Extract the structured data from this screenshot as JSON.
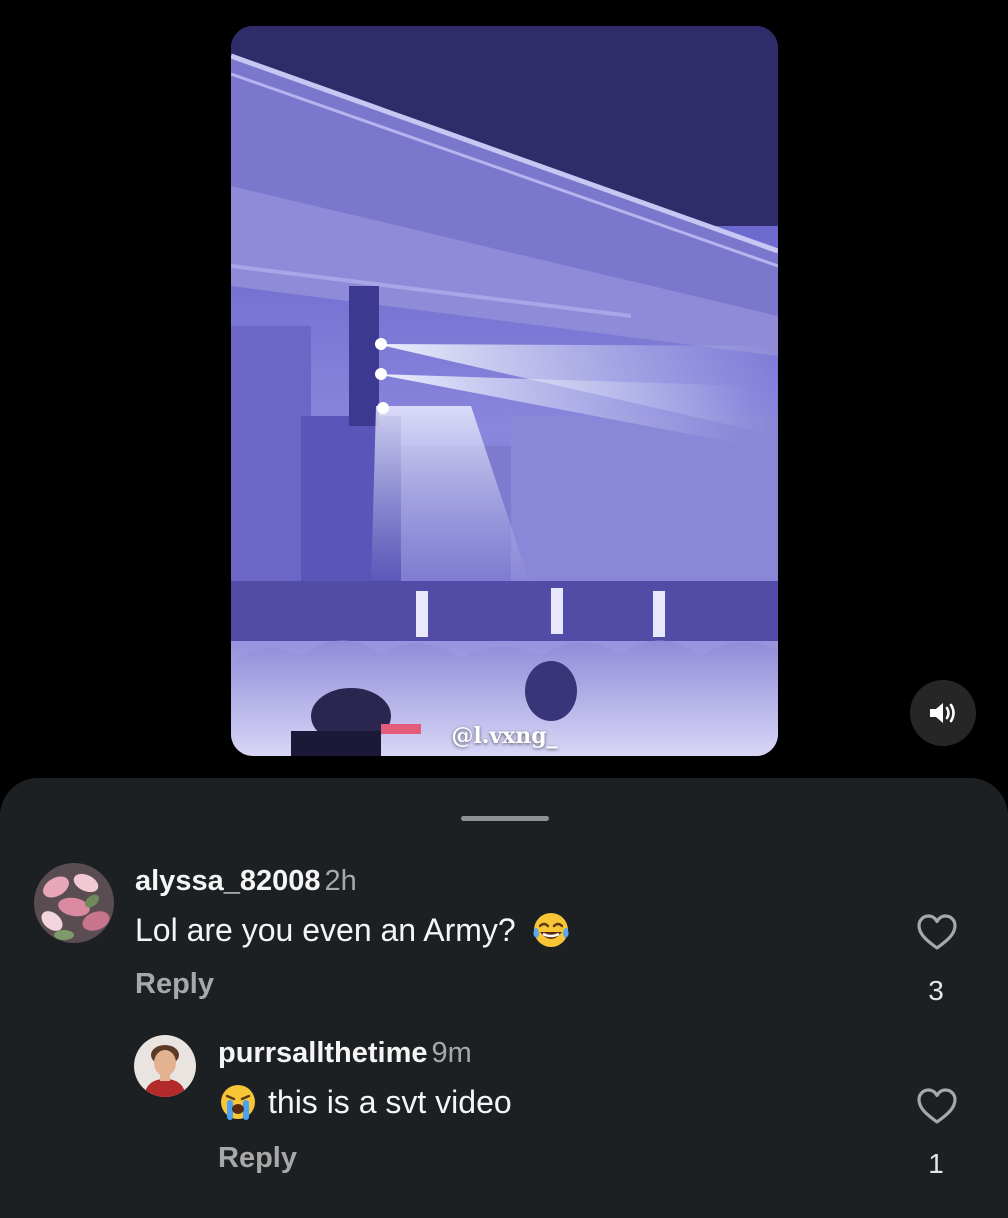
{
  "video": {
    "watermark": "@l.vxng_",
    "sound_icon": "speaker-volume-icon"
  },
  "comments": [
    {
      "username": "alyssa_82008",
      "time": "2h",
      "text": "Lol are you even an Army?",
      "emoji": "face-with-tears-of-joy",
      "reply_label": "Reply",
      "likes": "3",
      "like_icon": "heart-outline-icon",
      "avatar_icon": "flowers-avatar"
    },
    {
      "username": "purrsallthetime",
      "time": "9m",
      "text": "this is a svt video",
      "emoji": "loudly-crying-face",
      "reply_label": "Reply",
      "likes": "1",
      "like_icon": "heart-outline-icon",
      "avatar_icon": "person-avatar"
    }
  ],
  "colors": {
    "background": "#000000",
    "sheet": "#1c2023",
    "secondary_text": "#a8a8a8",
    "primary_text": "#f5f5f5"
  }
}
